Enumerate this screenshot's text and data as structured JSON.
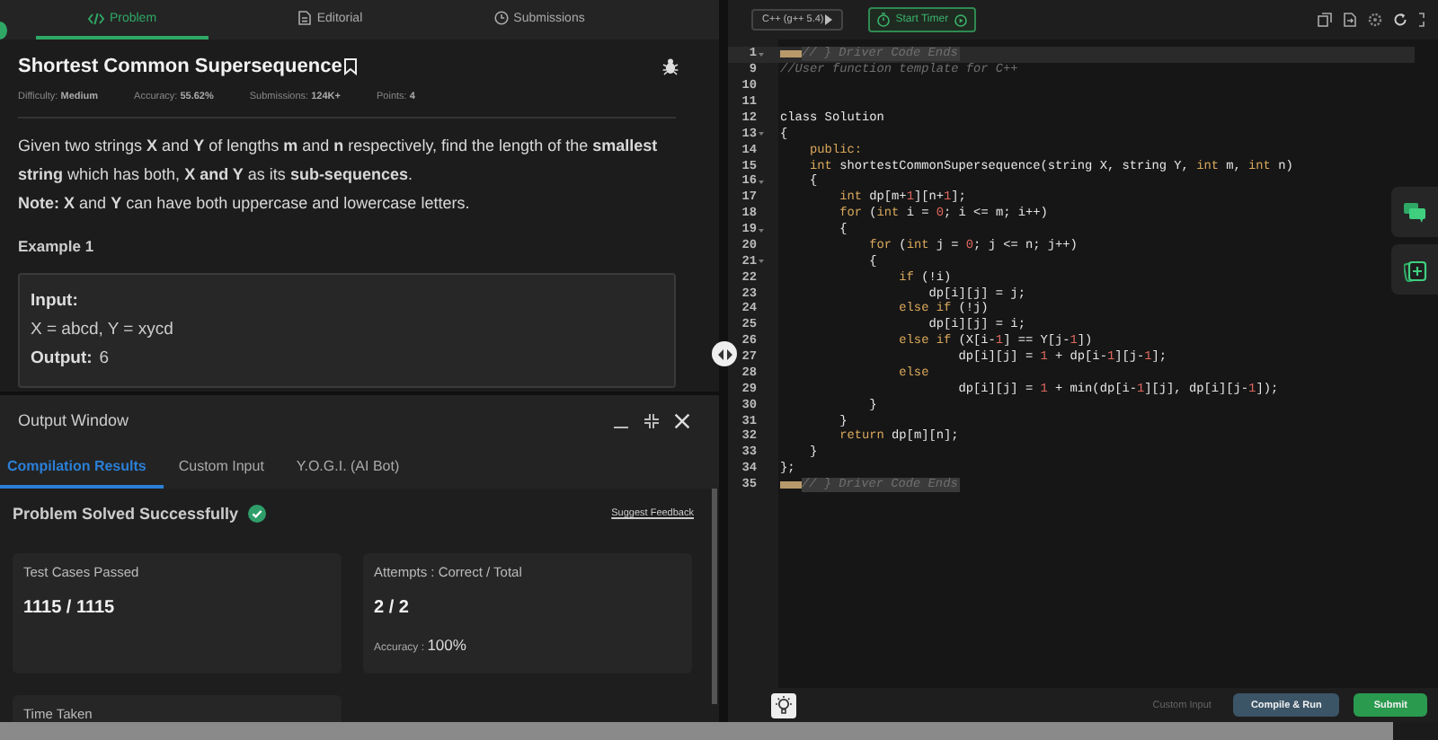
{
  "problem_tabs": [
    {
      "label": "Problem",
      "selected": true
    },
    {
      "label": "Editorial",
      "selected": false
    },
    {
      "label": "Submissions",
      "selected": false
    }
  ],
  "problem": {
    "title": "Shortest Common Supersequence",
    "meta": [
      {
        "label": "Difficulty:",
        "value": "Medium"
      },
      {
        "label": "Accuracy:",
        "value": "55.62%"
      },
      {
        "label": "Submissions:",
        "value": "124K+"
      },
      {
        "label": "Points:",
        "value": "4"
      }
    ],
    "description": [
      "Given two strings **X** and **Y** of lengths **m** and **n** respectively, find the length of the **smallest string** which has both, **X and Y** as its **sub-sequences**.",
      "**Note:** **X** and **Y** can have both uppercase and lowercase letters."
    ],
    "example_heading": "Example 1",
    "example_lines": [
      {
        "label": "Input:"
      },
      {
        "value": "X = abcd, Y = xycd"
      },
      {
        "label": "Output:",
        "value": "6"
      }
    ]
  },
  "output": {
    "title": "Output Window",
    "tabs": [
      {
        "label": "Compilation Results",
        "selected": true
      },
      {
        "label": "Custom Input",
        "selected": false
      },
      {
        "label": "Y.O.G.I. (AI Bot)",
        "selected": false
      }
    ],
    "status": "Problem Solved Successfully",
    "feedback_link": "Suggest Feedback",
    "cards": [
      {
        "title": "Test Cases Passed",
        "value": "1115 / 1115"
      },
      {
        "title": "Attempts : Correct / Total",
        "value": "2 / 2",
        "note_label": "Accuracy :",
        "note_value": "100%"
      },
      {
        "title": "Time Taken"
      }
    ]
  },
  "editor": {
    "language": "C++ (g++ 5.4)",
    "timer_button": "Start Timer",
    "lines": [
      {
        "number": "1",
        "foldable": true,
        "active": true,
        "tokens": [
          {
            "kind": "folded",
            "t": "// } Driver Code Ends"
          }
        ]
      },
      {
        "number": "9",
        "tokens": [
          {
            "kind": "comment",
            "t": "//User function template for C++"
          }
        ]
      },
      {
        "number": "10"
      },
      {
        "number": "11"
      },
      {
        "number": "12",
        "tokens": [
          {
            "kind": "plain",
            "t": "class Solution"
          }
        ]
      },
      {
        "number": "13",
        "foldable": true,
        "tokens": [
          {
            "kind": "plain",
            "t": "{"
          }
        ]
      },
      {
        "number": "14",
        "tokens": [
          {
            "kind": "keyword",
            "t": "    public:"
          }
        ]
      },
      {
        "number": "15",
        "tokens": [
          {
            "kind": "keyword",
            "t": "    int"
          },
          {
            "kind": "plain",
            "t": " shortestCommonSupersequence(string X, string Y, "
          },
          {
            "kind": "keyword",
            "t": "int"
          },
          {
            "kind": "plain",
            "t": " m, "
          },
          {
            "kind": "keyword",
            "t": "int"
          },
          {
            "kind": "plain",
            "t": " n)"
          }
        ]
      },
      {
        "number": "16",
        "foldable": true,
        "tokens": [
          {
            "kind": "plain",
            "t": "    {"
          }
        ]
      },
      {
        "number": "17",
        "tokens": [
          {
            "kind": "keyword",
            "t": "        int"
          },
          {
            "kind": "plain",
            "t": " dp[m+"
          },
          {
            "kind": "number",
            "t": "1"
          },
          {
            "kind": "plain",
            "t": "][n+"
          },
          {
            "kind": "number",
            "t": "1"
          },
          {
            "kind": "plain",
            "t": "];"
          }
        ]
      },
      {
        "number": "18",
        "tokens": [
          {
            "kind": "keyword",
            "t": "        for"
          },
          {
            "kind": "plain",
            "t": " ("
          },
          {
            "kind": "keyword",
            "t": "int"
          },
          {
            "kind": "plain",
            "t": " i = "
          },
          {
            "kind": "number",
            "t": "0"
          },
          {
            "kind": "plain",
            "t": "; i <= m; i++)"
          }
        ]
      },
      {
        "number": "19",
        "foldable": true,
        "tokens": [
          {
            "kind": "plain",
            "t": "        {"
          }
        ]
      },
      {
        "number": "20",
        "tokens": [
          {
            "kind": "keyword",
            "t": "            for"
          },
          {
            "kind": "plain",
            "t": " ("
          },
          {
            "kind": "keyword",
            "t": "int"
          },
          {
            "kind": "plain",
            "t": " j = "
          },
          {
            "kind": "number",
            "t": "0"
          },
          {
            "kind": "plain",
            "t": "; j <= n; j++)"
          }
        ]
      },
      {
        "number": "21",
        "foldable": true,
        "tokens": [
          {
            "kind": "plain",
            "t": "            {"
          }
        ]
      },
      {
        "number": "22",
        "tokens": [
          {
            "kind": "keyword",
            "t": "                if"
          },
          {
            "kind": "plain",
            "t": " (!i)"
          }
        ]
      },
      {
        "number": "23",
        "tokens": [
          {
            "kind": "plain",
            "t": "                    dp[i][j] = j;"
          }
        ]
      },
      {
        "number": "24",
        "tokens": [
          {
            "kind": "keyword",
            "t": "                else if"
          },
          {
            "kind": "plain",
            "t": " (!j)"
          }
        ]
      },
      {
        "number": "25",
        "tokens": [
          {
            "kind": "plain",
            "t": "                    dp[i][j] = i;"
          }
        ]
      },
      {
        "number": "26",
        "tokens": [
          {
            "kind": "keyword",
            "t": "                else if"
          },
          {
            "kind": "plain",
            "t": " (X[i-"
          },
          {
            "kind": "number",
            "t": "1"
          },
          {
            "kind": "plain",
            "t": "] == Y[j-"
          },
          {
            "kind": "number",
            "t": "1"
          },
          {
            "kind": "plain",
            "t": "])"
          }
        ]
      },
      {
        "number": "27",
        "tokens": [
          {
            "kind": "plain",
            "t": "                        dp[i][j] = "
          },
          {
            "kind": "number",
            "t": "1"
          },
          {
            "kind": "plain",
            "t": " + dp[i-"
          },
          {
            "kind": "number",
            "t": "1"
          },
          {
            "kind": "plain",
            "t": "][j-"
          },
          {
            "kind": "number",
            "t": "1"
          },
          {
            "kind": "plain",
            "t": "];"
          }
        ]
      },
      {
        "number": "28",
        "tokens": [
          {
            "kind": "keyword",
            "t": "                else"
          }
        ]
      },
      {
        "number": "29",
        "tokens": [
          {
            "kind": "plain",
            "t": "                        dp[i][j] = "
          },
          {
            "kind": "number",
            "t": "1"
          },
          {
            "kind": "plain",
            "t": " + min(dp[i-"
          },
          {
            "kind": "number",
            "t": "1"
          },
          {
            "kind": "plain",
            "t": "][j], dp[i][j-"
          },
          {
            "kind": "number",
            "t": "1"
          },
          {
            "kind": "plain",
            "t": "]);"
          }
        ]
      },
      {
        "number": "30",
        "tokens": [
          {
            "kind": "plain",
            "t": "            }"
          }
        ]
      },
      {
        "number": "31",
        "tokens": [
          {
            "kind": "plain",
            "t": "        }"
          }
        ]
      },
      {
        "number": "32",
        "tokens": [
          {
            "kind": "keyword",
            "t": "        return"
          },
          {
            "kind": "plain",
            "t": " dp[m][n];"
          }
        ]
      },
      {
        "number": "33",
        "tokens": [
          {
            "kind": "plain",
            "t": "    }"
          }
        ]
      },
      {
        "number": "34",
        "tokens": [
          {
            "kind": "plain",
            "t": "};"
          }
        ]
      },
      {
        "number": "35",
        "tokens": [
          {
            "kind": "folded",
            "t": "// } Driver Code Ends"
          }
        ]
      }
    ]
  },
  "footer": {
    "custom_input": "Custom Input",
    "run_button": "Compile & Run",
    "submit_button": "Submit"
  }
}
